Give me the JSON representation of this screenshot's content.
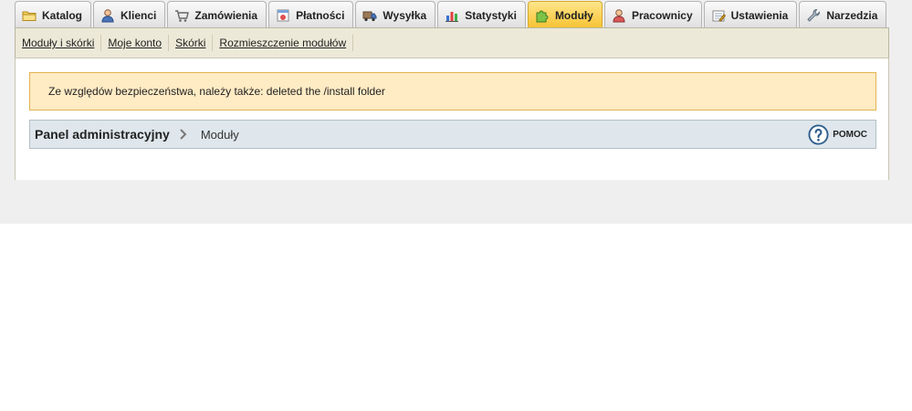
{
  "tabs": [
    {
      "label": "Katalog",
      "icon": "folder-icon",
      "active": false
    },
    {
      "label": "Klienci",
      "icon": "user-icon",
      "active": false
    },
    {
      "label": "Zamówienia",
      "icon": "cart-icon",
      "active": false
    },
    {
      "label": "Płatności",
      "icon": "payment-icon",
      "active": false
    },
    {
      "label": "Wysyłka",
      "icon": "truck-icon",
      "active": false
    },
    {
      "label": "Statystyki",
      "icon": "bar-chart-icon",
      "active": false
    },
    {
      "label": "Moduły",
      "icon": "puzzle-icon",
      "active": true
    },
    {
      "label": "Pracownicy",
      "icon": "employee-icon",
      "active": false
    },
    {
      "label": "Ustawienia",
      "icon": "settings-icon",
      "active": false
    },
    {
      "label": "Narzedzia",
      "icon": "wrench-icon",
      "active": false
    }
  ],
  "subnav": [
    {
      "label": "Moduły i skórki"
    },
    {
      "label": "Moje konto"
    },
    {
      "label": "Skórki"
    },
    {
      "label": "Rozmieszczenie modułów"
    }
  ],
  "warning": {
    "text": "Ze względów bezpieczeństwa, należy także: deleted the /install folder"
  },
  "breadcrumb": {
    "home": "Panel administracyjny",
    "current": "Moduły"
  },
  "help": {
    "label": "POMOC",
    "icon": "help-icon"
  },
  "colors": {
    "active_tab": "#f6c232",
    "warning_bg": "#ffebc4",
    "breadcrumb_bg": "#dfe7ec"
  }
}
